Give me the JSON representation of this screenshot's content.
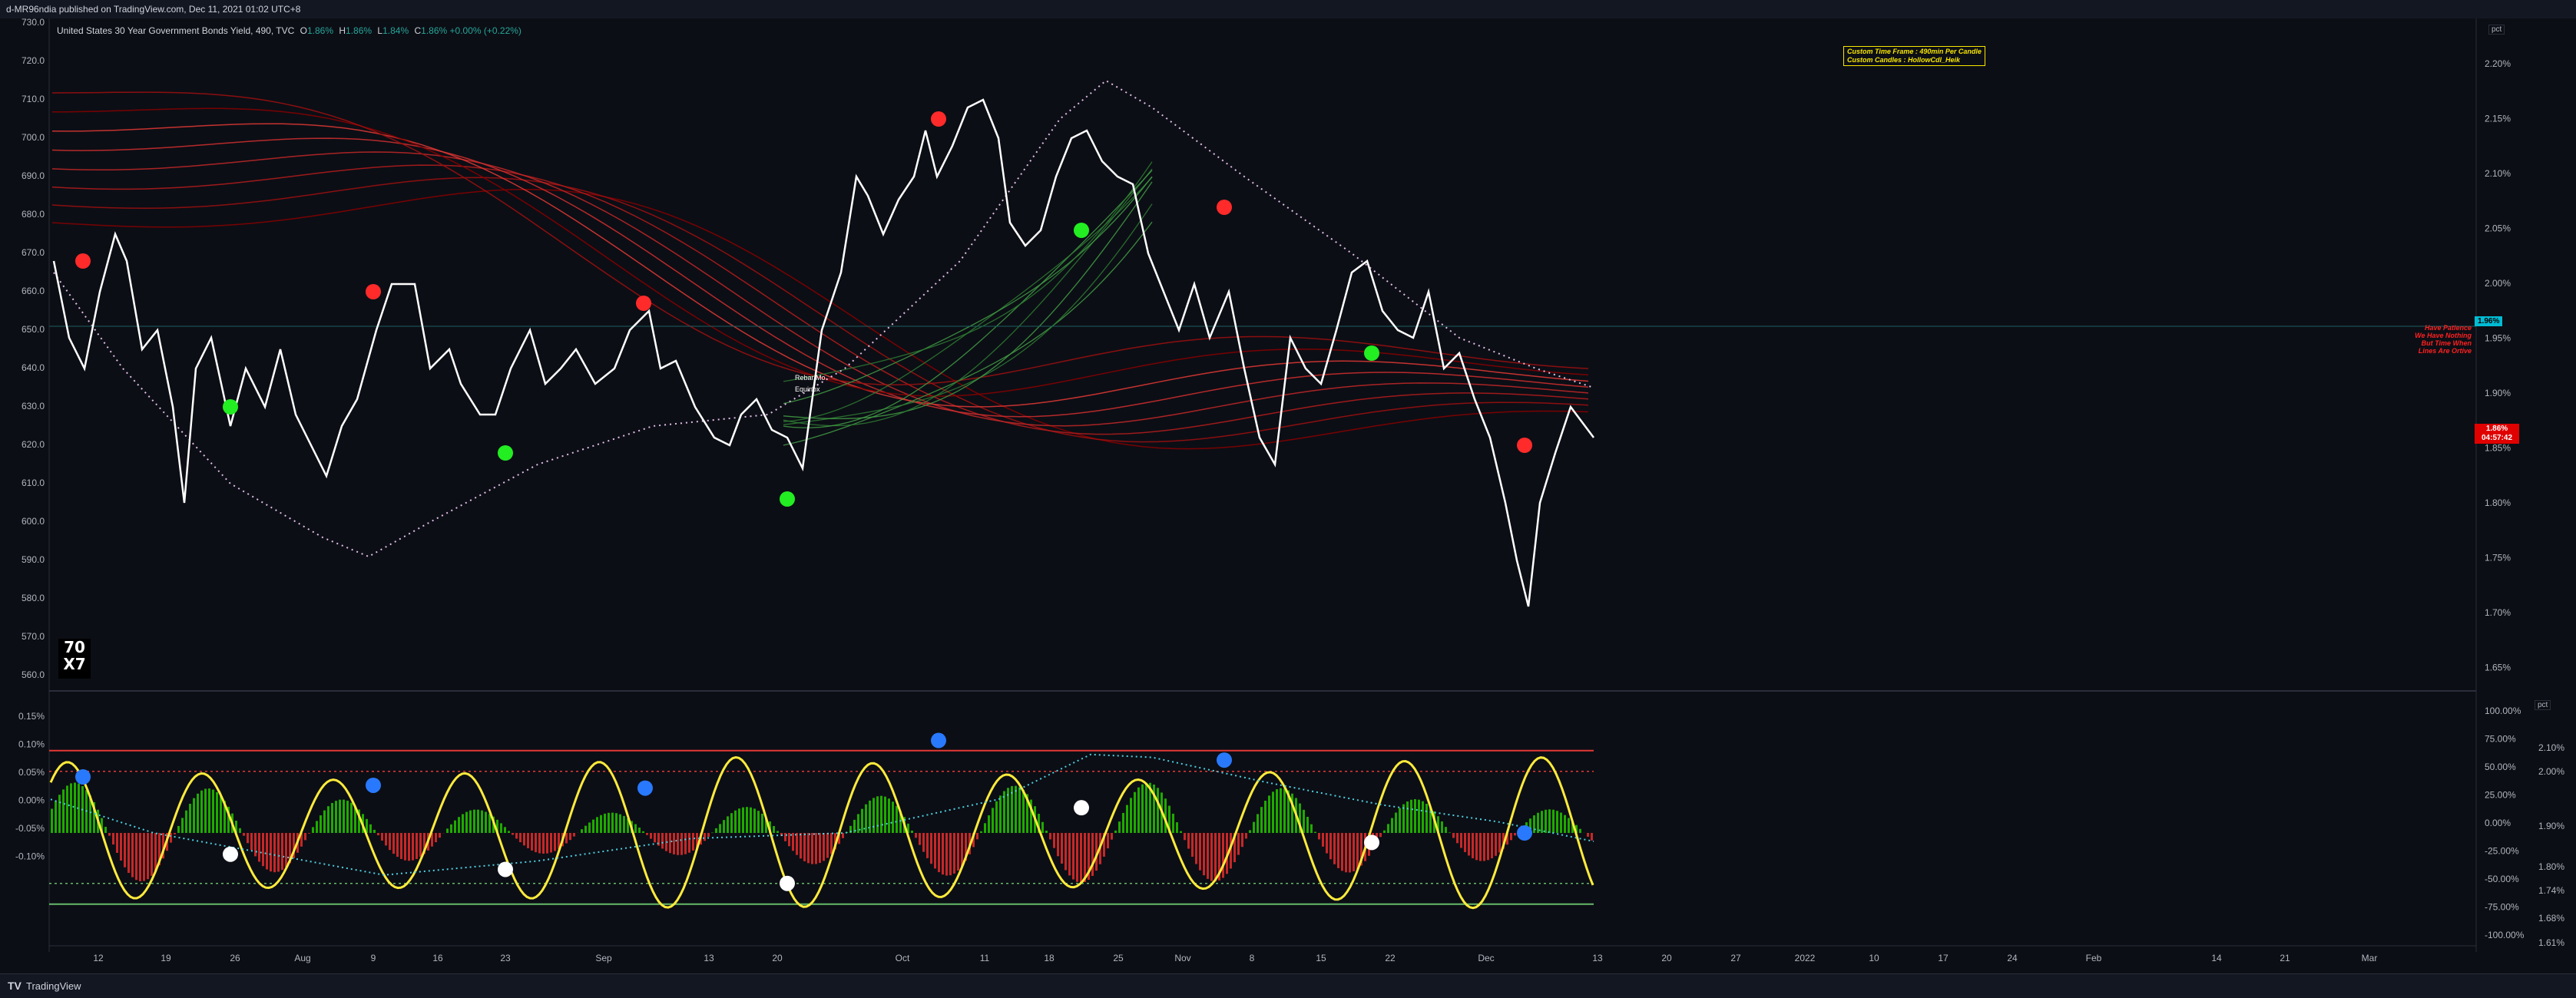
{
  "header": {
    "publish_line": "d-MR96ndia published on TradingView.com, Dec 11, 2021 01:02 UTC+8"
  },
  "legend": {
    "title": "United States 30 Year Government Bonds Yield, 490, TVC",
    "o_label": "O",
    "o_value": "1.86%",
    "h_label": "H",
    "h_value": "1.86%",
    "l_label": "L",
    "l_value": "1.84%",
    "c_label": "C",
    "c_value": "1.86%",
    "change": "+0.00% (+0.22%)"
  },
  "info_box": {
    "line1": "Custom Time Frame : 490min Per Candle",
    "line2": "Custom Candles : HollowCdl_Heik"
  },
  "red_note": [
    "Have Patience",
    "We Have Nothing",
    "But Time When",
    "Lines Are Ortive"
  ],
  "price_tags": {
    "blue": "1.96%",
    "red_value": "1.86%",
    "red_timer": "04:57:42"
  },
  "pct_button": "pct",
  "logo_text": {
    "line1": "70",
    "line2": "X7"
  },
  "annotation": {
    "line1": "Rebar/Mo",
    "line2": "Equinox"
  },
  "left_axis_main": [
    "730.0",
    "720.0",
    "710.0",
    "700.0",
    "690.0",
    "680.0",
    "670.0",
    "660.0",
    "650.0",
    "640.0",
    "630.0",
    "620.0",
    "610.0",
    "600.0",
    "590.0",
    "580.0",
    "570.0",
    "560.0"
  ],
  "left_axis_osc": [
    "0.15%",
    "0.10%",
    "0.05%",
    "0.00%",
    "-0.05%",
    "-0.10%"
  ],
  "right_axis_main": [
    "2.20%",
    "2.15%",
    "2.10%",
    "2.05%",
    "2.00%",
    "1.95%",
    "1.90%",
    "1.85%",
    "1.80%",
    "1.75%",
    "1.70%",
    "1.65%"
  ],
  "right_axis_osc_pct": [
    "100.00%",
    "75.00%",
    "50.00%",
    "25.00%",
    "0.00%",
    "-25.00%",
    "-50.00%",
    "-75.00%",
    "-100.00%"
  ],
  "right_axis_osc_yield": [
    "2.10%",
    "2.00%",
    "1.90%",
    "1.80%",
    "1.74%",
    "1.68%",
    "1.61%"
  ],
  "x_axis": [
    "12",
    "19",
    "26",
    "Aug",
    "9",
    "16",
    "23",
    "Sep",
    "13",
    "20",
    "Oct",
    "11",
    "18",
    "25",
    "Nov",
    "8",
    "15",
    "22",
    "Dec",
    "13",
    "20",
    "27",
    "2022",
    "10",
    "17",
    "24",
    "Feb",
    "14",
    "21",
    "Mar"
  ],
  "footer": {
    "brand": "TradingView",
    "logo": "TV"
  },
  "colors": {
    "bg": "#0c0e15",
    "white_line": "#ffffff",
    "red_ribbon": "#b71c1c",
    "green_ribbon": "#2e7d32",
    "dots": "#e040fb",
    "yellow": "#ffeb3b",
    "osc_green": "#1faa00",
    "osc_red": "#c62828",
    "cyan": "#4dd0e1",
    "blue_dot": "#2979ff"
  }
}
